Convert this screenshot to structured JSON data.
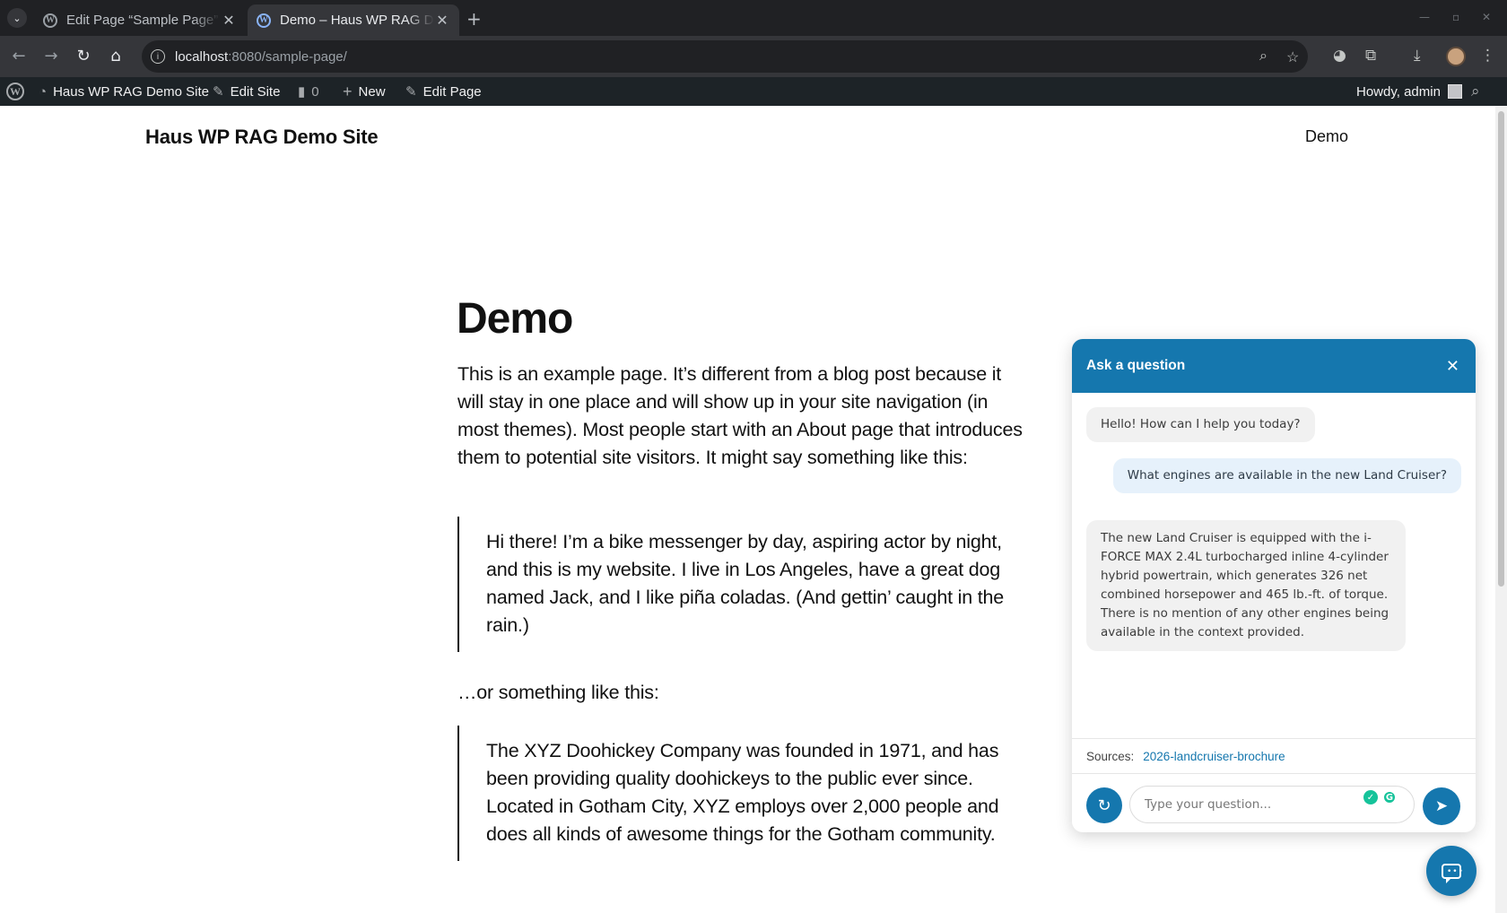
{
  "browser": {
    "tabs": [
      {
        "title": "Edit Page “Sample Page”",
        "active": false
      },
      {
        "title": "Demo – Haus WP RAG Demo Site",
        "active": true
      }
    ],
    "url_host": "localhost",
    "url_rest": ":8080/sample-page/"
  },
  "adminbar": {
    "site_name": "Haus WP RAG Demo Site",
    "edit_site": "Edit Site",
    "comments_count": "0",
    "new_label": "New",
    "edit_page": "Edit Page",
    "howdy": "Howdy, admin"
  },
  "site": {
    "title": "Haus WP RAG Demo Site",
    "nav_items": [
      "Demo"
    ]
  },
  "page": {
    "title": "Demo",
    "intro": "This is an example page. It’s different from a blog post because it will stay in one place and will show up in your site navigation (in most themes). Most people start with an About page that introduces them to potential site visitors. It might say something like this:",
    "quote1": "Hi there! I’m a bike messenger by day, aspiring actor by night, and this is my website. I live in Los Angeles, have a great dog named Jack, and I like piña coladas. (And gettin’ caught in the rain.)",
    "between": "…or something like this:",
    "quote2": "The XYZ Doohickey Company was founded in 1971, and has been providing quality doohickeys to the public ever since. Located in Gotham City, XYZ employs over 2,000 people and does all kinds of awesome things for the Gotham community."
  },
  "chat": {
    "title": "Ask a question",
    "messages": [
      {
        "role": "bot",
        "text": "Hello! How can I help you today?"
      },
      {
        "role": "user",
        "text": "What engines are available in the new Land Cruiser?"
      },
      {
        "role": "bot",
        "text": "The new Land Cruiser is equipped with the i-FORCE MAX 2.4L turbocharged inline 4-cylinder hybrid powertrain, which generates 326 net combined horsepower and 465 lb.-ft. of torque. There is no mention of any other engines being available in the context provided."
      }
    ],
    "sources_label": "Sources:",
    "sources": [
      "2026-landcruiser-brochure"
    ],
    "input_placeholder": "Type your question...",
    "accent_color": "#1577ae"
  }
}
